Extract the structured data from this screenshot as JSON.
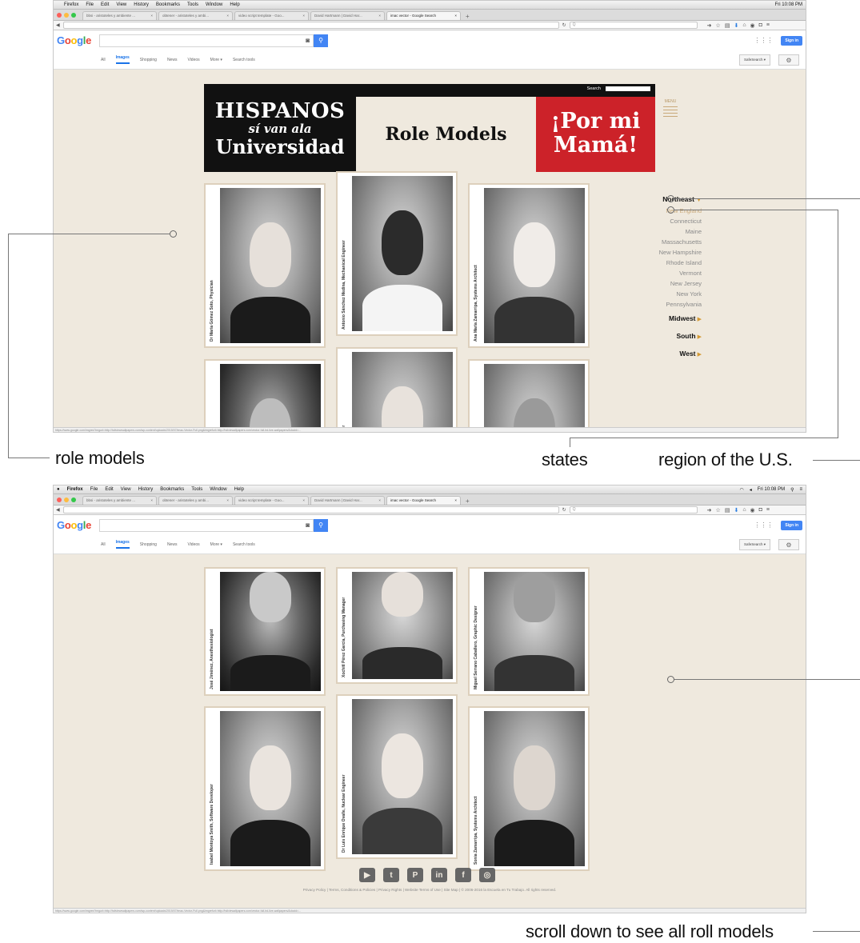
{
  "browser": {
    "menu_apple": "",
    "menu_items": [
      "Firefox",
      "File",
      "Edit",
      "View",
      "History",
      "Bookmarks",
      "Tools",
      "Window",
      "Help"
    ],
    "clock": "Fri 10:08 PM",
    "tabs": [
      {
        "label": "bbsi - aristoteles y ambiente ...",
        "active": false
      },
      {
        "label": "obtener - aristoteles y ambi...",
        "active": false
      },
      {
        "label": "video script template - Goo...",
        "active": false
      },
      {
        "label": "David Hartmann | David Har...",
        "active": false
      },
      {
        "label": "imac vector - Google Search",
        "active": true
      }
    ],
    "search_placeholder": "Q",
    "status_url": "https://www.google.com/imgres?imgurl=http://hdiviewwallpapers.com/wp-content/uploads/2015/07/imac-Vector-Full.png&imgrefurl=http://hdiviewallpapers.com/vector-full-hd-live-wallpapers/&docid=..."
  },
  "google": {
    "logo_letters": [
      "G",
      "o",
      "o",
      "g",
      "l",
      "e"
    ],
    "logo_colors": [
      "#4285f4",
      "#ea4335",
      "#fbbc05",
      "#4285f4",
      "#34a853",
      "#ea4335"
    ],
    "camera_icon": "camera-icon",
    "search_icon": "search-icon",
    "signin": "Sign in",
    "tabs": [
      "All",
      "Images",
      "Shopping",
      "News",
      "Videos",
      "More ▾",
      "Search tools"
    ],
    "selected_tab": "Images",
    "safesearch": "SafeSearch ▾"
  },
  "site": {
    "search_label": "Search",
    "title_line1": "HISPANOS",
    "title_line2": "sí van ala",
    "title_line3": "Universidad",
    "middle_title": "Role Models",
    "right_line1": "¡Por mi",
    "right_line2": "Mamá!",
    "menu_label": "MENU",
    "regions": {
      "northeast": "Northeast",
      "sub": "New England",
      "states": [
        "Connecticut",
        "Maine",
        "Massachusetts",
        "New Hampshire",
        "Rhode Island",
        "Vermont",
        "New Jersey",
        "New York",
        "Pennsylvania"
      ],
      "midwest": "Midwest",
      "south": "South",
      "west": "West"
    },
    "top_captions": [
      "Dr María Gómez Soto, Physician",
      "Antonio Sánchez Medina, Mechanical Engineer",
      "Ana María Zamarripa, Systems Architect"
    ],
    "row2_captions": [
      "José Jiménez, Anesthesiologist",
      "Xochitl Pérez García, Purchasing Manager",
      "Miguel Serrano Caballero, Graphic Designer"
    ],
    "row3_captions": [
      "Isabel Montoya Smith, Software Developer",
      "Dr Luis Enrique Ovalle, Nuclear Engineer",
      "Sonia Zamarripa, Systems Architect"
    ],
    "social": [
      "▶",
      "t",
      "P",
      "in",
      "f",
      "◎"
    ],
    "footer": "Privacy Policy | Terms, Conditions & Policies | Privacy Rights | Website Terms of Use | Site Map | © 2006-2016 la Escuela en Tu Trabajo. All rights reserved."
  },
  "labels": {
    "role_models": "role models",
    "states": "states",
    "region": "region of the U.S.",
    "scroll": "scroll down to see all roll models"
  }
}
